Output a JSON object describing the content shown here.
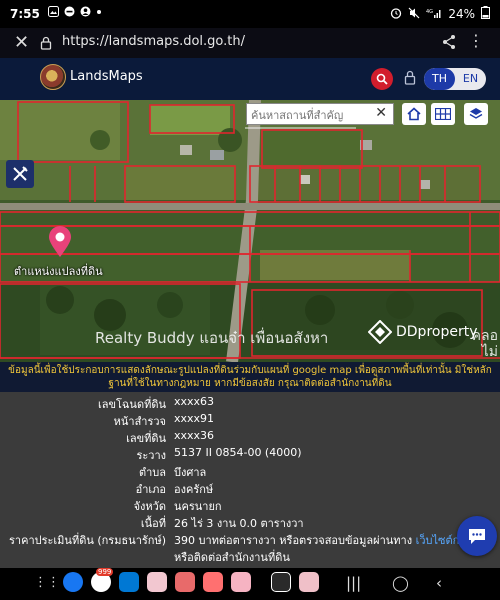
{
  "status_bar": {
    "time": "7:55",
    "battery": "24%"
  },
  "browser": {
    "url": "https://landsmaps.dol.go.th/"
  },
  "header": {
    "brand": "LandsMaps",
    "lang_th": "TH",
    "lang_en": "EN"
  },
  "map": {
    "search_placeholder": "ค้นหาสถานที่สำคัญ",
    "pin_label": "ตำแหน่งแปลงที่ดิน",
    "watermark": "Realty Buddy แอนจ๋า เพื่อนอสังหา",
    "ddproperty": "DDproperty",
    "corner_text_1": "คลอ",
    "corner_text_2": "ไม่"
  },
  "notice": "ข้อมูลนี้เพื่อใช้ประกอบการแสดงลักษณะรูปแปลงที่ดินร่วมกับแผนที่ google map เพื่อดูสภาพพื้นที่เท่านั้น มิใช่หลักฐานที่ใช้ในทางกฎหมาย หากมีข้อสงสัย กรุณาติดต่อสำนักงานที่ดิน",
  "info": {
    "rows": [
      {
        "label": "เลขโฉนดที่ดิน",
        "value": "xxxx63"
      },
      {
        "label": "หน้าสำรวจ",
        "value": "xxxx91"
      },
      {
        "label": "เลขที่ดิน",
        "value": "xxxx36"
      },
      {
        "label": "ระวาง",
        "value": "5137 II 0854-00 (4000)"
      },
      {
        "label": "ตำบล",
        "value": "บึงศาล"
      },
      {
        "label": "อำเภอ",
        "value": "องครักษ์"
      },
      {
        "label": "จังหวัด",
        "value": "นครนายก"
      },
      {
        "label": "เนื้อที่",
        "value": "26 ไร่ 3 งาน 0.0 ตารางวา"
      }
    ],
    "price_label": "ราคาประเมินที่ดิน (กรมธนารักษ์)",
    "price_value": "390 บาทต่อตารางวา หรือตรวจสอบข้อมูลผ่านทาง ",
    "price_link": "เว็บไซต์กรมธ",
    "price_value_2": "หรือติดต่อสำนักงานที่ดิน"
  },
  "nav": {
    "badge": "999"
  },
  "colors": {
    "header_bg": "#0b1a3a",
    "accent_blue": "#1d3aa8",
    "search_red": "#d21d2c",
    "notice_text": "#f0c63a",
    "parcel_lines": "#e0262e"
  }
}
